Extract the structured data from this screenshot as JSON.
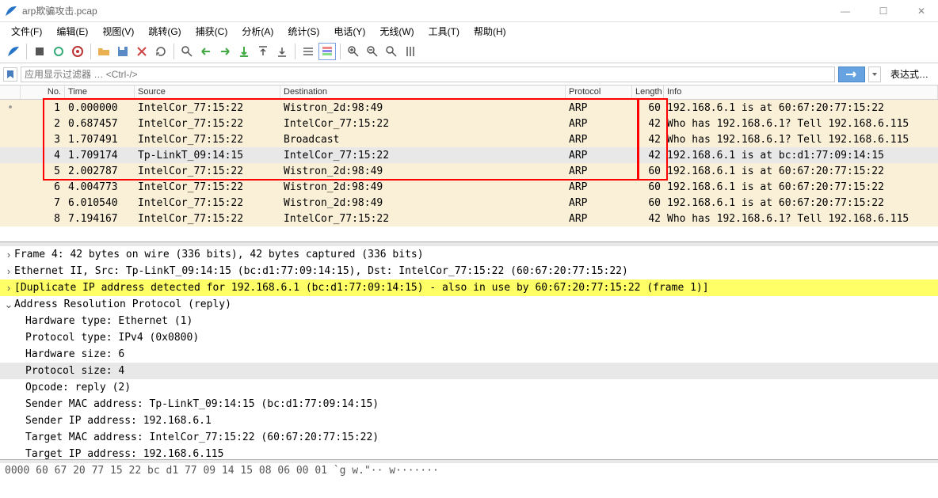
{
  "window": {
    "title": "arp欺骗攻击.pcap"
  },
  "menu": [
    "文件(F)",
    "编辑(E)",
    "视图(V)",
    "跳转(G)",
    "捕获(C)",
    "分析(A)",
    "统计(S)",
    "电话(Y)",
    "无线(W)",
    "工具(T)",
    "帮助(H)"
  ],
  "filter": {
    "placeholder": "应用显示过滤器 … <Ctrl-/>",
    "expression": "表达式…"
  },
  "columns": {
    "no": "No.",
    "time": "Time",
    "source": "Source",
    "destination": "Destination",
    "protocol": "Protocol",
    "length": "Length",
    "info": "Info"
  },
  "packets": [
    {
      "no": 1,
      "mark": "•",
      "time": "0.000000",
      "src": "IntelCor_77:15:22",
      "dst": "Wistron_2d:98:49",
      "proto": "ARP",
      "len": 60,
      "info": "192.168.6.1 is at 60:67:20:77:15:22",
      "bg": 1
    },
    {
      "no": 2,
      "mark": "",
      "time": "0.687457",
      "src": "IntelCor_77:15:22",
      "dst": "IntelCor_77:15:22",
      "proto": "ARP",
      "len": 42,
      "info": "Who has 192.168.6.1? Tell 192.168.6.115",
      "bg": 1
    },
    {
      "no": 3,
      "mark": "",
      "time": "1.707491",
      "src": "IntelCor_77:15:22",
      "dst": "Broadcast",
      "proto": "ARP",
      "len": 42,
      "info": "Who has 192.168.6.1? Tell 192.168.6.115",
      "bg": 1
    },
    {
      "no": 4,
      "mark": "",
      "time": "1.709174",
      "src": "Tp-LinkT_09:14:15",
      "dst": "IntelCor_77:15:22",
      "proto": "ARP",
      "len": 42,
      "info": "192.168.6.1 is at bc:d1:77:09:14:15",
      "bg": 2
    },
    {
      "no": 5,
      "mark": "",
      "time": "2.002787",
      "src": "IntelCor_77:15:22",
      "dst": "Wistron_2d:98:49",
      "proto": "ARP",
      "len": 60,
      "info": "192.168.6.1 is at 60:67:20:77:15:22",
      "bg": 1
    },
    {
      "no": 6,
      "mark": "",
      "time": "4.004773",
      "src": "IntelCor_77:15:22",
      "dst": "Wistron_2d:98:49",
      "proto": "ARP",
      "len": 60,
      "info": "192.168.6.1 is at 60:67:20:77:15:22",
      "bg": 1
    },
    {
      "no": 7,
      "mark": "",
      "time": "6.010540",
      "src": "IntelCor_77:15:22",
      "dst": "Wistron_2d:98:49",
      "proto": "ARP",
      "len": 60,
      "info": "192.168.6.1 is at 60:67:20:77:15:22",
      "bg": 1
    },
    {
      "no": 8,
      "mark": "",
      "time": "7.194167",
      "src": "IntelCor_77:15:22",
      "dst": "IntelCor_77:15:22",
      "proto": "ARP",
      "len": 42,
      "info": "Who has 192.168.6.1? Tell 192.168.6.115",
      "bg": 1
    }
  ],
  "details": {
    "frame": "Frame 4: 42 bytes on wire (336 bits), 42 bytes captured (336 bits)",
    "eth": "Ethernet II, Src: Tp-LinkT_09:14:15 (bc:d1:77:09:14:15), Dst: IntelCor_77:15:22 (60:67:20:77:15:22)",
    "dup": "[Duplicate IP address detected for 192.168.6.1 (bc:d1:77:09:14:15) - also in use by 60:67:20:77:15:22 (frame 1)]",
    "arp": "Address Resolution Protocol (reply)",
    "fields": [
      "Hardware type: Ethernet (1)",
      "Protocol type: IPv4 (0x0800)",
      "Hardware size: 6",
      "Protocol size: 4",
      "Opcode: reply (2)",
      "Sender MAC address: Tp-LinkT_09:14:15 (bc:d1:77:09:14:15)",
      "Sender IP address: 192.168.6.1",
      "Target MAC address: IntelCor_77:15:22 (60:67:20:77:15:22)",
      "Target IP address: 192.168.6.115"
    ]
  },
  "hex": "0000   60 67 20 77 15 22 bc d1  77 09 14 15 08 06 00 01   `g w.\"·· w·······"
}
